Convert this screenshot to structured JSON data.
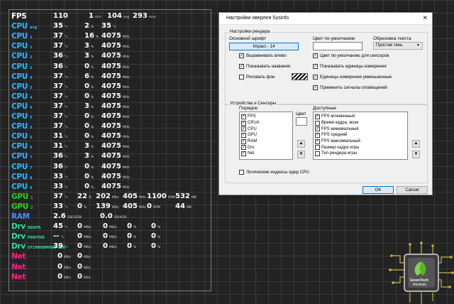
{
  "overlay": {
    "rows": [
      {
        "label": "FPS",
        "sub": "",
        "cls": "c-fps",
        "cells": [
          {
            "v": "110",
            "u": ""
          },
          {
            "v": "1",
            "u": "min"
          },
          {
            "v": "104",
            "u": "avg"
          },
          {
            "v": "293",
            "u": "max"
          }
        ]
      },
      {
        "label": "CPU",
        "sub": "avg",
        "cls": "c-cpu",
        "cells": [
          {
            "v": "35",
            "u": "°c"
          },
          {
            "v": "2",
            "u": "%"
          },
          {
            "v": "35",
            "u": "°c"
          }
        ]
      },
      {
        "label": "CPU",
        "sub": "1",
        "cls": "c-cpu",
        "cells": [
          {
            "v": "37",
            "u": "°c"
          },
          {
            "v": "16",
            "u": "%"
          },
          {
            "v": "4075",
            "u": "MHz"
          }
        ]
      },
      {
        "label": "CPU",
        "sub": "1",
        "cls": "c-cpu",
        "cells": [
          {
            "v": "37",
            "u": "°c"
          },
          {
            "v": "3",
            "u": "%"
          },
          {
            "v": "4075",
            "u": "MHz"
          }
        ]
      },
      {
        "label": "CPU",
        "sub": "2",
        "cls": "c-cpu",
        "cells": [
          {
            "v": "36",
            "u": "°c"
          },
          {
            "v": "3",
            "u": "%"
          },
          {
            "v": "4075",
            "u": "MHz"
          }
        ]
      },
      {
        "label": "CPU",
        "sub": "2",
        "cls": "c-cpu",
        "cells": [
          {
            "v": "36",
            "u": "°c"
          },
          {
            "v": "0",
            "u": "%"
          },
          {
            "v": "4075",
            "u": "MHz"
          }
        ]
      },
      {
        "label": "CPU",
        "sub": "3",
        "cls": "c-cpu",
        "cells": [
          {
            "v": "37",
            "u": "°c"
          },
          {
            "v": "6",
            "u": "%"
          },
          {
            "v": "4075",
            "u": "MHz"
          }
        ]
      },
      {
        "label": "CPU",
        "sub": "3",
        "cls": "c-cpu",
        "cells": [
          {
            "v": "37",
            "u": "°c"
          },
          {
            "v": "0",
            "u": "%"
          },
          {
            "v": "4075",
            "u": "MHz"
          }
        ]
      },
      {
        "label": "CPU",
        "sub": "4",
        "cls": "c-cpu",
        "cells": [
          {
            "v": "37",
            "u": "°c"
          },
          {
            "v": "0",
            "u": "%"
          },
          {
            "v": "4075",
            "u": "MHz"
          }
        ]
      },
      {
        "label": "CPU",
        "sub": "4",
        "cls": "c-cpu",
        "cells": [
          {
            "v": "37",
            "u": "°c"
          },
          {
            "v": "3",
            "u": "%"
          },
          {
            "v": "4075",
            "u": "MHz"
          }
        ]
      },
      {
        "label": "CPU",
        "sub": "5",
        "cls": "c-cpu",
        "cells": [
          {
            "v": "37",
            "u": "°c"
          },
          {
            "v": "0",
            "u": "%"
          },
          {
            "v": "4075",
            "u": "MHz"
          }
        ]
      },
      {
        "label": "CPU",
        "sub": "5",
        "cls": "c-cpu",
        "cells": [
          {
            "v": "37",
            "u": "°c"
          },
          {
            "v": "0",
            "u": "%"
          },
          {
            "v": "4075",
            "u": "MHz"
          }
        ]
      },
      {
        "label": "CPU",
        "sub": "6",
        "cls": "c-cpu",
        "cells": [
          {
            "v": "31",
            "u": "°c"
          },
          {
            "v": "0",
            "u": "%"
          },
          {
            "v": "4075",
            "u": "MHz"
          }
        ]
      },
      {
        "label": "CPU",
        "sub": "6",
        "cls": "c-cpu",
        "cells": [
          {
            "v": "31",
            "u": "°c"
          },
          {
            "v": "3",
            "u": "%"
          },
          {
            "v": "4075",
            "u": "MHz"
          }
        ]
      },
      {
        "label": "CPU",
        "sub": "7",
        "cls": "c-cpu",
        "cells": [
          {
            "v": "36",
            "u": "°c"
          },
          {
            "v": "3",
            "u": "%"
          },
          {
            "v": "4075",
            "u": "MHz"
          }
        ]
      },
      {
        "label": "CPU",
        "sub": "7",
        "cls": "c-cpu",
        "cells": [
          {
            "v": "36",
            "u": "°c"
          },
          {
            "v": "0",
            "u": "%"
          },
          {
            "v": "4075",
            "u": "MHz"
          }
        ]
      },
      {
        "label": "CPU",
        "sub": "8",
        "cls": "c-cpu",
        "cells": [
          {
            "v": "33",
            "u": "°c"
          },
          {
            "v": "0",
            "u": "%"
          },
          {
            "v": "4075",
            "u": "MHz"
          }
        ]
      },
      {
        "label": "CPU",
        "sub": "8",
        "cls": "c-cpu",
        "cells": [
          {
            "v": "33",
            "u": "°c"
          },
          {
            "v": "0",
            "u": "%"
          },
          {
            "v": "4075",
            "u": "MHz"
          }
        ]
      }
    ],
    "gpu_rows": [
      {
        "label": "GPU",
        "sub": "1",
        "cls": "c-gpu",
        "cells": [
          {
            "v": "37",
            "u": "°c"
          },
          {
            "v": "22",
            "u": "%"
          },
          {
            "v": "202",
            "u": "MHz"
          },
          {
            "v": "405",
            "u": "MHz"
          },
          {
            "v": "1100",
            "u": "RPM"
          },
          {
            "v": "532",
            "u": "MB"
          }
        ]
      },
      {
        "label": "GPU",
        "sub": "2",
        "cls": "c-gpu",
        "cells": [
          {
            "v": "33",
            "u": "°c"
          },
          {
            "v": "0",
            "u": "%"
          },
          {
            "v": "139",
            "u": "MHz"
          },
          {
            "v": "405",
            "u": "MHz"
          },
          {
            "v": "0",
            "u": "RPM"
          },
          {
            "v": "44",
            "u": "MB"
          }
        ]
      }
    ],
    "ram": {
      "label": "RAM",
      "used": "2.6",
      "used_u": "GB/32GB",
      "free": "0.0",
      "free_u": "GB/4GB"
    },
    "drives": [
      {
        "label": "Drv",
        "sub": "DDATA",
        "temp": "45",
        "u1": "°c",
        "vals": [
          "0",
          "0",
          "0",
          "0"
        ]
      },
      {
        "label": "Drv",
        "sub": "PDDTOO",
        "temp": "--",
        "u1": "°c",
        "vals": [
          "0",
          "0",
          "0",
          "0"
        ]
      },
      {
        "label": "Drv",
        "sub": "ST1000DM001-1ER",
        "temp": "39",
        "u1": "°c",
        "vals": [
          "0",
          "0",
          "0",
          "0"
        ]
      }
    ],
    "drive_units": [
      "MB/s",
      "MB/s",
      "%",
      "%"
    ],
    "nets": [
      {
        "label": "Net",
        "a": "0",
        "au": "KB/s",
        "b": "0",
        "bu": "KB/s"
      },
      {
        "label": "Net",
        "a": "0",
        "au": "KB/s",
        "b": "0",
        "bu": "KB/s"
      },
      {
        "label": "Net",
        "a": "0",
        "au": "KB/s",
        "b": "0",
        "bu": "KB/s"
      }
    ]
  },
  "dialog": {
    "title": "Настройки оверлея Sysinfo",
    "render_group": "Настройки рендера",
    "font_label": "Основной шрифт",
    "font_value": "Impact - 14",
    "default_color_label": "Цвет по-умолчанию",
    "trim_label": "Обрезовка текста",
    "trim_value": "Простая тень",
    "left_checks": [
      {
        "label": "Выравнивать влево",
        "checked": true
      },
      {
        "label": "Показывать названия",
        "checked": true
      },
      {
        "label": "Рисовать фон",
        "checked": false
      }
    ],
    "right_checks": [
      {
        "label": "Цвет по-умолчанию для сенсоров",
        "checked": true
      },
      {
        "label": "Показывать единицы измерения",
        "checked": true
      },
      {
        "label": "Единицы измерения уменьшенные",
        "checked": true
      },
      {
        "label": "Применять сигналы оповещений",
        "checked": true
      }
    ],
    "devices_group": "Устройства и Сенсоры",
    "order_label": "Порядок:",
    "color_label": "Цвет",
    "available_label": "Доступные",
    "order_items": [
      {
        "label": "FPS",
        "checked": true
      },
      {
        "label": "CPUA",
        "checked": true
      },
      {
        "label": "CPU",
        "checked": true
      },
      {
        "label": "GPU",
        "checked": true
      },
      {
        "label": "RAM",
        "checked": true
      },
      {
        "label": "Drv",
        "checked": true
      },
      {
        "label": "Net",
        "checked": true
      }
    ],
    "available_items": [
      {
        "label": "FPS мгновенный",
        "checked": true
      },
      {
        "label": "Время кадра, мсек",
        "checked": false
      },
      {
        "label": "FPS минимальный",
        "checked": true
      },
      {
        "label": "FPS средний",
        "checked": true
      },
      {
        "label": "FPS максимальный",
        "checked": true
      },
      {
        "label": "Размер кадра игры",
        "checked": false
      },
      {
        "label": "Тип рендера игры",
        "checked": false
      }
    ],
    "logical_cpu_label": "Логические индексы ядер CPU",
    "logical_cpu_checked": false,
    "ok_label": "OK",
    "cancel_label": "Cancel"
  },
  "logo": {
    "line1": "GreenTech",
    "line2": "Reviews"
  }
}
